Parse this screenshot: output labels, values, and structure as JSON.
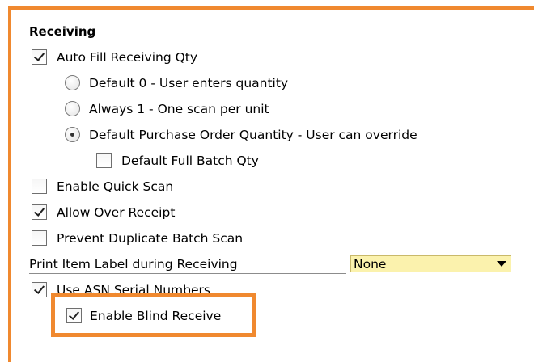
{
  "section": {
    "title": "Receiving"
  },
  "options": {
    "auto_fill": {
      "label": "Auto Fill Receiving Qty",
      "checked": true
    },
    "radio_default0": {
      "label": "Default 0 - User enters quantity",
      "selected": false
    },
    "radio_always1": {
      "label": "Always 1 - One scan per unit",
      "selected": false
    },
    "radio_default_po": {
      "label": "Default Purchase Order Quantity - User can override",
      "selected": true
    },
    "default_full_batch": {
      "label": "Default Full Batch Qty",
      "checked": false
    },
    "enable_quick_scan": {
      "label": "Enable Quick Scan",
      "checked": false
    },
    "allow_over_receipt": {
      "label": "Allow Over Receipt",
      "checked": true
    },
    "prevent_duplicate": {
      "label": "Prevent Duplicate Batch Scan",
      "checked": false
    },
    "print_label": {
      "label": "Print Item Label during Receiving",
      "value": "None"
    },
    "use_asn": {
      "label": "Use ASN Serial Numbers",
      "checked": true
    },
    "blind_receive": {
      "label": "Enable Blind Receive",
      "checked": true
    }
  },
  "colors": {
    "highlight": "#f0892f",
    "dropdown_bg": "#fbf2ad"
  }
}
